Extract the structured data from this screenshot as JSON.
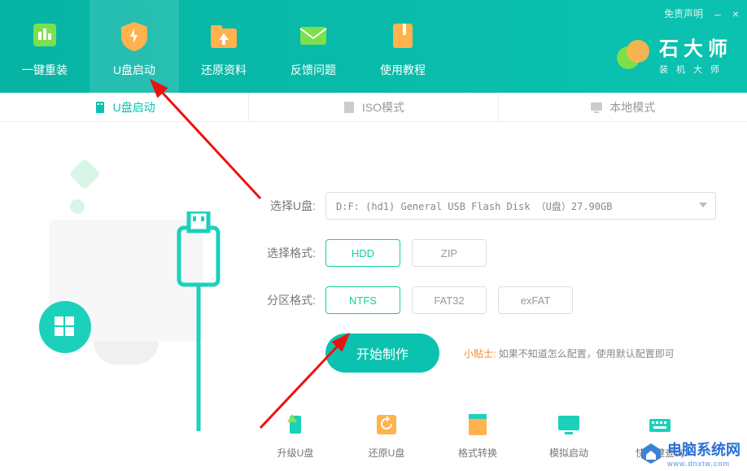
{
  "titlebar": {
    "disclaimer": "免责声明",
    "min": "–",
    "close": "×"
  },
  "nav": {
    "reinstall": "一键重装",
    "usb_boot": "U盘启动",
    "restore": "还原资料",
    "feedback": "反馈问题",
    "tutorial": "使用教程"
  },
  "brand": {
    "title": "石大师",
    "sub": "装机大师"
  },
  "subtabs": {
    "usb": "U盘启动",
    "iso": "ISO模式",
    "local": "本地模式"
  },
  "form": {
    "select_usb_label": "选择U盘:",
    "select_usb_value": "D:F: (hd1) General USB Flash Disk （U盘）27.90GB",
    "format_label": "选择格式:",
    "format_hdd": "HDD",
    "format_zip": "ZIP",
    "fs_label": "分区格式:",
    "fs_ntfs": "NTFS",
    "fs_fat32": "FAT32",
    "fs_exfat": "exFAT",
    "start": "开始制作",
    "tip_prefix": "小贴士:",
    "tip_body": "如果不知道怎么配置，使用默认配置即可"
  },
  "tools": {
    "upgrade": "升级U盘",
    "restore": "还原U盘",
    "convert": "格式转换",
    "simboot": "模拟启动",
    "shortcut": "快捷键查询"
  },
  "watermark": {
    "name": "电脑系统网",
    "url": "www.dnxtw.com"
  }
}
